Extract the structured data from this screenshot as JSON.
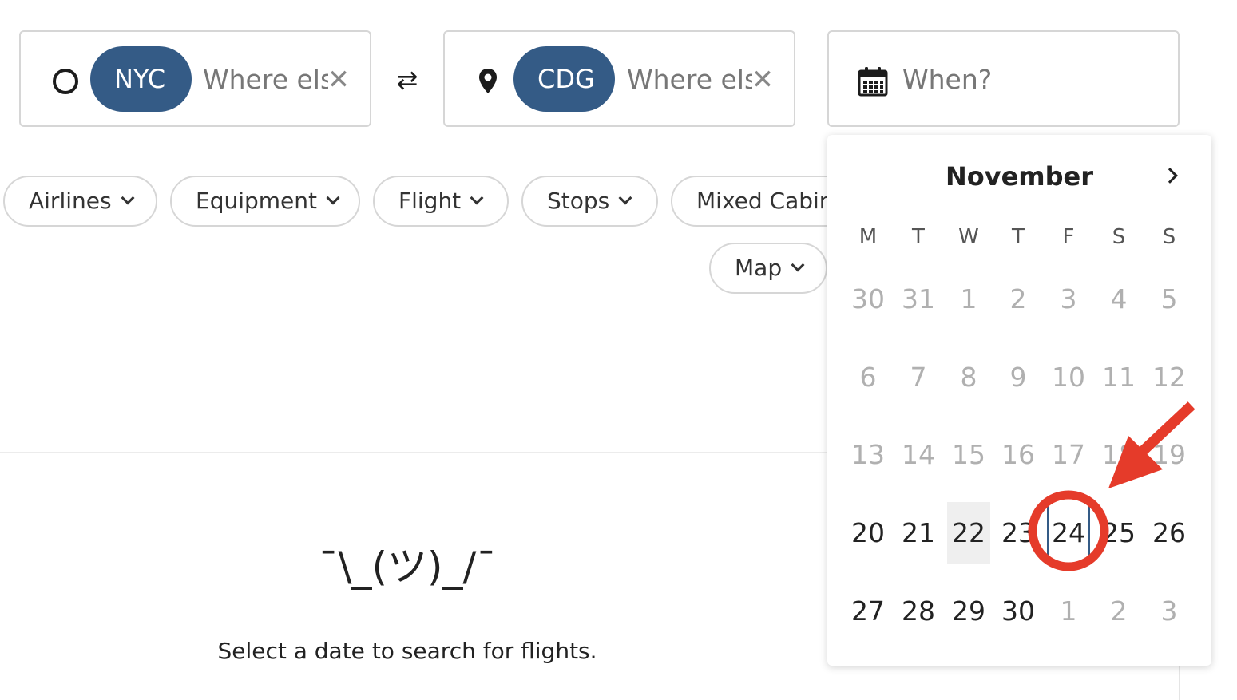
{
  "search": {
    "origin": {
      "chip": "NYC",
      "placeholder": "Where else?"
    },
    "swap_icon": "swap-icon",
    "destination": {
      "chip": "CDG",
      "placeholder": "Where else?"
    },
    "when": {
      "placeholder": "When?"
    }
  },
  "filters": [
    "Airlines",
    "Equipment",
    "Flight",
    "Stops",
    "Mixed Cabins",
    "Map"
  ],
  "empty_state": {
    "emoticon": "¯\\_(ツ)_/¯",
    "message": "Select a date to search for flights."
  },
  "calendar": {
    "month": "November",
    "weekdays": [
      "M",
      "T",
      "W",
      "T",
      "F",
      "S",
      "S"
    ],
    "weeks": [
      [
        {
          "d": "30",
          "m": true
        },
        {
          "d": "31",
          "m": true
        },
        {
          "d": "1",
          "m": true
        },
        {
          "d": "2",
          "m": true
        },
        {
          "d": "3",
          "m": true
        },
        {
          "d": "4",
          "m": true
        },
        {
          "d": "5",
          "m": true
        }
      ],
      [
        {
          "d": "6",
          "m": true
        },
        {
          "d": "7",
          "m": true
        },
        {
          "d": "8",
          "m": true
        },
        {
          "d": "9",
          "m": true
        },
        {
          "d": "10",
          "m": true
        },
        {
          "d": "11",
          "m": true
        },
        {
          "d": "12",
          "m": true
        }
      ],
      [
        {
          "d": "13",
          "m": true
        },
        {
          "d": "14",
          "m": true
        },
        {
          "d": "15",
          "m": true
        },
        {
          "d": "16",
          "m": true
        },
        {
          "d": "17",
          "m": true
        },
        {
          "d": "18",
          "m": true
        },
        {
          "d": "19",
          "m": true
        }
      ],
      [
        {
          "d": "20",
          "m": false
        },
        {
          "d": "21",
          "m": false
        },
        {
          "d": "22",
          "m": false,
          "today": true
        },
        {
          "d": "23",
          "m": false
        },
        {
          "d": "24",
          "m": false,
          "focus": true
        },
        {
          "d": "25",
          "m": false
        },
        {
          "d": "26",
          "m": false
        }
      ],
      [
        {
          "d": "27",
          "m": false
        },
        {
          "d": "28",
          "m": false
        },
        {
          "d": "29",
          "m": false
        },
        {
          "d": "30",
          "m": false
        },
        {
          "d": "1",
          "m": true
        },
        {
          "d": "2",
          "m": true
        },
        {
          "d": "3",
          "m": true
        }
      ]
    ]
  },
  "colors": {
    "chip": "#345b86",
    "annotation": "#e53b2a",
    "today_bg": "#efefef",
    "muted_day": "#b0b0b0"
  }
}
